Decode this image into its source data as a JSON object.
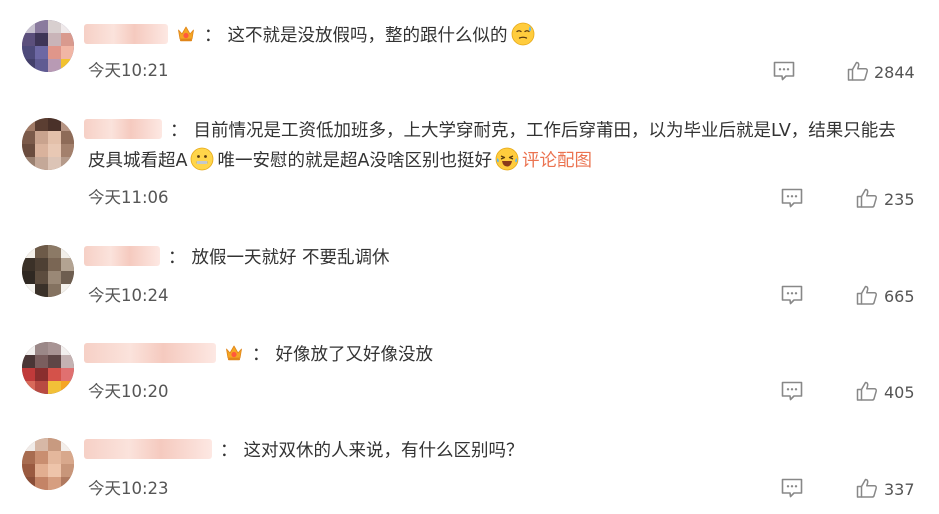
{
  "comments": [
    {
      "colon": "：",
      "text_a": "这不就是没放假吗，整的跟什么似的",
      "time": "今天10:21",
      "likes": "2844"
    },
    {
      "colon": "：",
      "text_a": "目前情况是工资低加班多，上大学穿耐克，工作后穿莆田，以为毕业后就是LV，结果只能去",
      "text_b": "皮具城看超A",
      "text_c": "唯一安慰的就是超A没啥区别也挺好",
      "image_link": "评论配图",
      "time": "今天11:06",
      "likes": "235"
    },
    {
      "colon": "：",
      "text_a": "放假一天就好 不要乱调休",
      "time": "今天10:24",
      "likes": "665"
    },
    {
      "colon": "：",
      "text_a": "好像放了又好像没放",
      "time": "今天10:20",
      "likes": "405"
    },
    {
      "colon": "：",
      "text_a": "这对双休的人来说，有什么区别吗？",
      "time": "今天10:23",
      "likes": "337"
    }
  ],
  "icons": {
    "badge": "crown-badge-icon",
    "reply": "comment-bubble-icon",
    "like": "thumbs-up-icon",
    "emoji_1": "sweat-face-emoji",
    "emoji_2": "zipper-mouth-emoji",
    "emoji_3": "laughing-crying-emoji"
  },
  "colors": {
    "link": "#eb7350",
    "text": "#333333",
    "meta": "#555555",
    "icon": "#888888"
  }
}
